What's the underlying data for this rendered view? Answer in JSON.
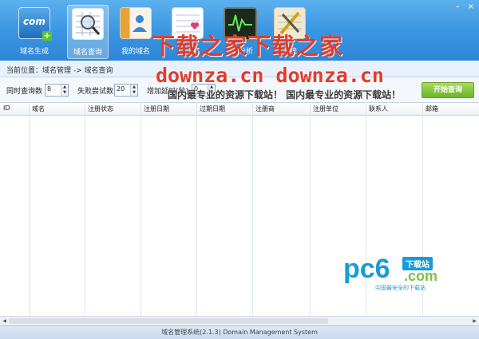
{
  "window": {
    "minimize": "–",
    "close": "×"
  },
  "toolbar": {
    "items": [
      {
        "label": "域名生成",
        "icon": "com-icon"
      },
      {
        "label": "域名查询",
        "icon": "search-grid-icon"
      },
      {
        "label": "我的域名",
        "icon": "address-book-icon"
      },
      {
        "label": "域名",
        "icon": "favorite-list-icon"
      },
      {
        "label": "分析",
        "icon": "monitor-chart-icon"
      },
      {
        "label": "系统",
        "icon": "settings-tools-icon"
      }
    ],
    "com_text": "com"
  },
  "watermark": {
    "line1": "下载之家下载之家",
    "line2": "downza.cn downza.cn",
    "line3": "国内最专业的资源下载站！ 国内最专业的资源下载站！"
  },
  "breadcrumb": "当前位置：域名管理 -> 域名查询",
  "params": {
    "concurrent_label": "同时查询数",
    "concurrent_value": "8",
    "retry_label": "失败尝试数",
    "retry_value": "20",
    "interval_label": "增加延时(秒)",
    "interval_value": "0",
    "start_button": "开始查询"
  },
  "table": {
    "columns": [
      "ID",
      "域名",
      "注册状态",
      "注册日期",
      "过期日期",
      "注册商",
      "注册单位",
      "联系人",
      "邮箱"
    ],
    "rows": []
  },
  "logo": {
    "brand": "pc6",
    "badge": "下载站",
    "domain": ".com",
    "tagline": "中国最安全的下载站"
  },
  "status": "域名管理系统(2.1.3) Domain Management System",
  "colors": {
    "accent": "#3a94e0",
    "start_button": "#6cb529",
    "watermark": "#e43b2a",
    "logo_blue": "#1a9bd7",
    "logo_green": "#7bc144"
  }
}
